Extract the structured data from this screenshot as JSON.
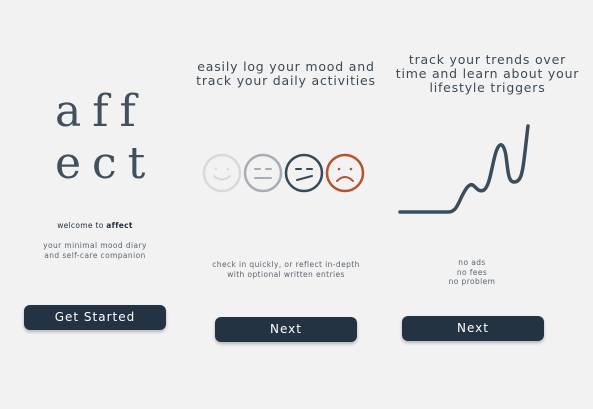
{
  "screens": [
    {
      "logo": {
        "line1": "aff",
        "line2": "ect"
      },
      "welcome_prefix": "welcome to ",
      "welcome_brand": "affect",
      "tagline": [
        "your minimal mood diary",
        "and self-care companion"
      ],
      "button": "Get Started"
    },
    {
      "headline": [
        "easily log your mood and",
        "track your daily activities"
      ],
      "faces": [
        {
          "name": "happy",
          "color": "#d9d9d9"
        },
        {
          "name": "neutral",
          "color": "#a7adb2"
        },
        {
          "name": "unsure",
          "color": "#34495a"
        },
        {
          "name": "sad",
          "color": "#b4532e"
        }
      ],
      "caption": [
        "check in quickly, or reflect in-depth",
        "with optional written entries"
      ],
      "button": "Next"
    },
    {
      "headline": [
        "track your trends over",
        "time and learn about your",
        "lifestyle triggers"
      ],
      "trend_color": "#3b4d5a",
      "perks": [
        "no ads",
        "no fees",
        "no problem"
      ],
      "button": "Next"
    }
  ]
}
